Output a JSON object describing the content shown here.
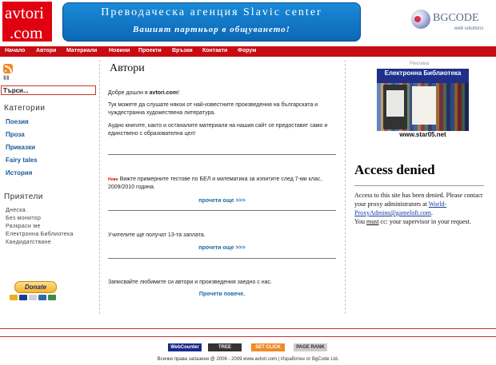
{
  "header": {
    "logo_line1": "avtori",
    "logo_line2": ".com",
    "banner_title": "Преводаческа агенция Slavic center",
    "banner_tagline": "Вашият партньор в общуването!",
    "sponsor_logo": "BGCODE",
    "sponsor_sub": "web solutions"
  },
  "nav": [
    "Начало",
    "Автори",
    "Материали",
    "Новини",
    "Проекти",
    "Връзки",
    "Контакти",
    "Форум"
  ],
  "sidebar": {
    "search_value": "Търси...",
    "categories_heading": "Категории",
    "categories": [
      "Поезия",
      "Проза",
      "Приказки",
      "Fairy tales",
      "История"
    ],
    "friends_heading": "Приятели",
    "friends": [
      "Днеска.",
      "Без монитор",
      "Разкраси ме",
      "Електронна Библиотека",
      "Кандидатстване"
    ],
    "donate_label": "Donate"
  },
  "main": {
    "title": "Автори",
    "welcome_prefix": "Добре дошли в ",
    "welcome_site": "avtori.com",
    "welcome_suffix": "!",
    "intro": "Тук можете да слушате някои от най-известните произведения на българската и чуждестранна художествена литература.",
    "audio_note": "Аудио книгите, както и останалите материали на нашия сайт се предоставят само и единствено с образователна цел!",
    "news": [
      {
        "badge": "Ново",
        "text": "Вижте примерните тестове по БЕЛ и математика за изпитите след 7-ми клас, 2009/2010 година.",
        "link": "прочети още >>>"
      },
      {
        "badge": "",
        "text": "Учителите ще получат 13-та заплата.",
        "link": "прочети още >>>"
      },
      {
        "badge": "",
        "text": "Записвайте любимите си автори и произведения заедно с нас.",
        "link": "Прочети повече."
      }
    ]
  },
  "right": {
    "ad_label": "Реклама",
    "ad_title": "Електронна Библиотека",
    "ad_url": "www.star05.net",
    "access_heading": "Access denied",
    "access_text1": "Access to this site has been denied. Please contact your proxy administrators at ",
    "access_link": "World-ProxyAdmins@gameloft.com",
    "access_text2": ".",
    "access_text3_pre": "You ",
    "access_text3_must": "must",
    "access_text3_post": " cc: your supervisor in your request."
  },
  "footer": {
    "badges": [
      "WebCounter",
      "TREE",
      "SET CLICK",
      "PAGE RANK"
    ],
    "copyright": "Всички права запазени @ 2006 - 2009 www.avtori.com | Изработен от BgCode Ltd."
  },
  "colors": {
    "brand_red": "#c70c14",
    "banner_blue": "#1a8ad8",
    "link_blue": "#1a6aa8"
  }
}
